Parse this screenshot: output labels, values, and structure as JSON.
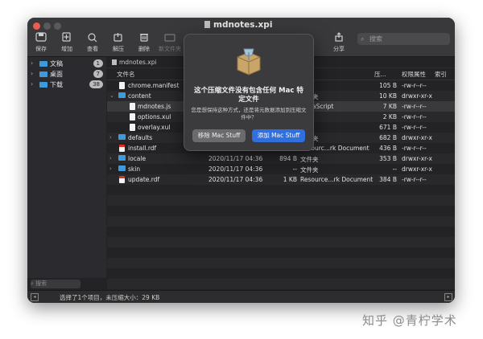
{
  "window": {
    "title": "mdnotes.xpi"
  },
  "toolbar": {
    "save": "保存",
    "add": "增加",
    "view": "查看",
    "extract": "解压",
    "delete": "删除",
    "new_folder": "新文件夹",
    "share": "分享",
    "search_placeholder": "搜索"
  },
  "sidebar": {
    "items": [
      {
        "label": "文稿",
        "badge": "1"
      },
      {
        "label": "桌面",
        "badge": "7"
      },
      {
        "label": "下载",
        "badge": "38"
      }
    ],
    "search_placeholder": "搜索"
  },
  "path": {
    "label": "mdnotes.xpi"
  },
  "columns": {
    "name": "文件名",
    "compressed": "压...",
    "permissions": "权限属性",
    "index": "索引"
  },
  "rows": [
    {
      "name": "chrome.manifest",
      "date": "",
      "csize": "",
      "kind": "",
      "size": "105 B",
      "perm": "-rw-r--r--"
    },
    {
      "name": "content",
      "date": "",
      "csize": "",
      "kind": "夹",
      "size": "10 KB",
      "perm": "drwxr-xr-x"
    },
    {
      "name": "mdnotes.js",
      "date": "",
      "csize": "",
      "kind": "aScript",
      "size": "7 KB",
      "perm": "-rw-r--r--"
    },
    {
      "name": "options.xul",
      "date": "",
      "csize": "",
      "kind": "",
      "size": "2 KB",
      "perm": "-rw-r--r--"
    },
    {
      "name": "overlay.xul",
      "date": "",
      "csize": "",
      "kind": "",
      "size": "671 B",
      "perm": "-rw-r--r--"
    },
    {
      "name": "defaults",
      "date": "",
      "csize": "",
      "kind": "夹",
      "size": "682 B",
      "perm": "drwxr-xr-x"
    },
    {
      "name": "install.rdf",
      "date": "",
      "csize": "",
      "kind": "Resourc...rk Document",
      "size": "436 B",
      "perm": "-rw-r--r--"
    },
    {
      "name": "locale",
      "date": "2020/11/17 04:36",
      "csize": "894 B",
      "kind": "文件夹",
      "size": "353 B",
      "perm": "drwxr-xr-x"
    },
    {
      "name": "skin",
      "date": "2020/11/17 04:36",
      "csize": "--",
      "kind": "文件夹",
      "size": "--",
      "perm": "drwxr-xr-x"
    },
    {
      "name": "update.rdf",
      "date": "2020/11/17 04:36",
      "csize": "1 KB",
      "kind": "Resource...rk Document",
      "size": "384 B",
      "perm": "-rw-r--r--"
    }
  ],
  "status": {
    "text": "选择了1个项目，未压缩大小：29 KB"
  },
  "dialog": {
    "title": "这个压缩文件没有包含任何 Mac 特定文件",
    "message": "您是想保持这种方式，还是将元数据添加到压缩文件中？",
    "remove_button": "移除 Mac Stuff",
    "add_button": "添加 Mac Stuff"
  },
  "watermark": "知乎 @青柠学术",
  "colors": {
    "accent": "#2f6fe0",
    "folder": "#3d9bdc",
    "close": "#ee5a52"
  }
}
